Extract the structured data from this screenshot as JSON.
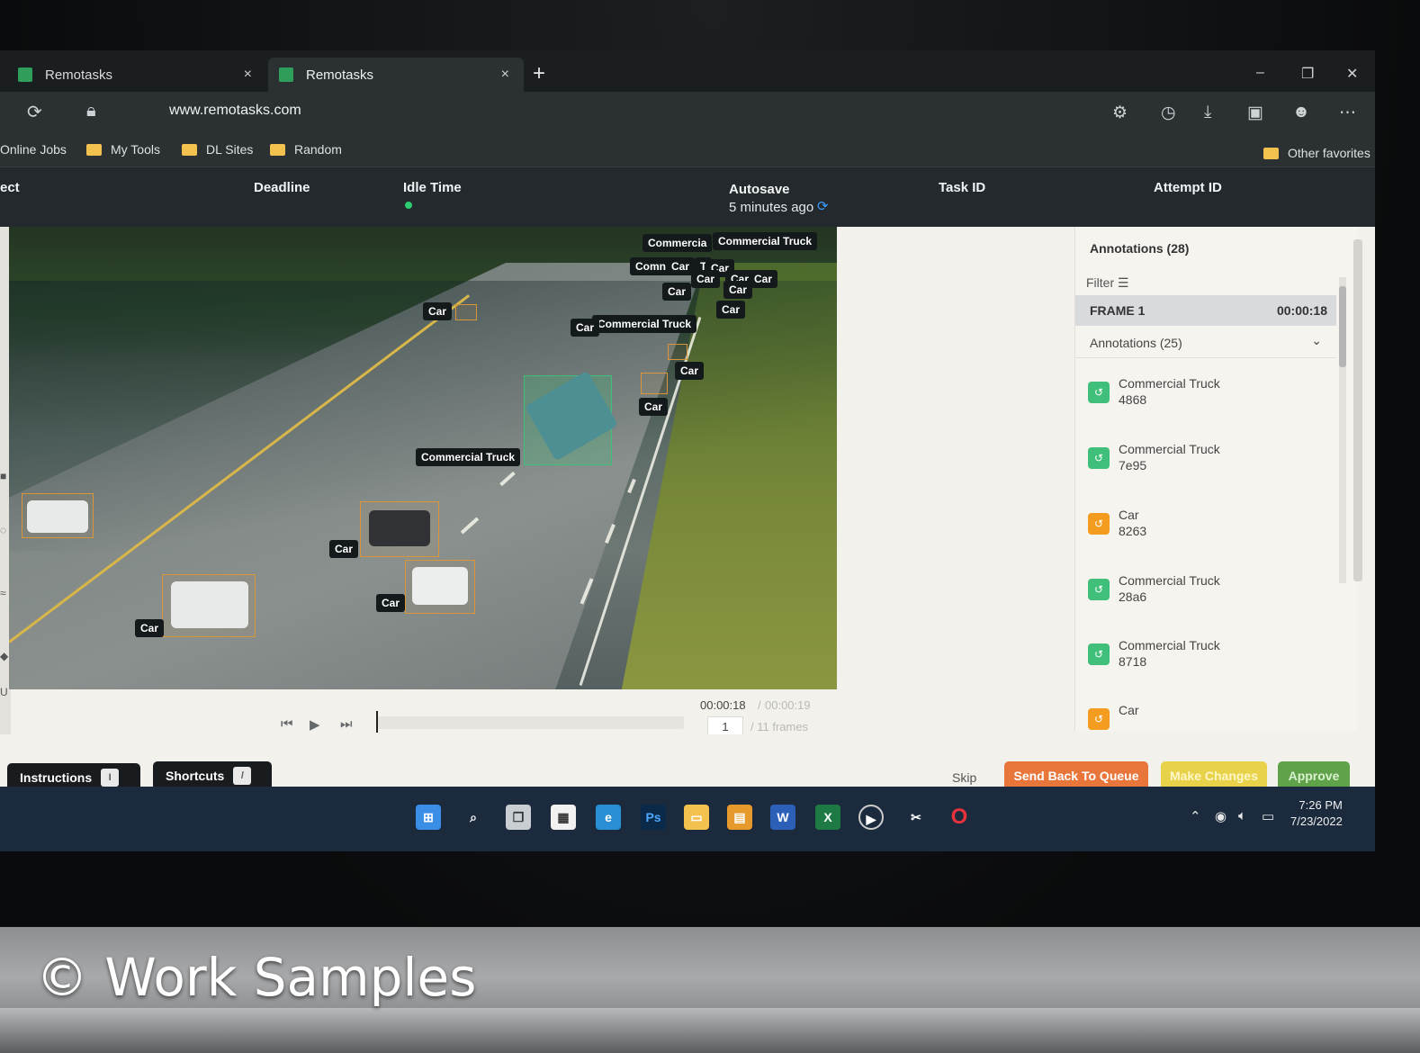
{
  "browser": {
    "tabs": [
      {
        "label": "Remotasks",
        "close": "×"
      },
      {
        "label": "Remotasks",
        "close": "×"
      }
    ],
    "new_tab": "+",
    "window_controls": [
      "–",
      "❐",
      "✕"
    ],
    "url": "www.remotasks.com",
    "favorites": [
      "Online Jobs",
      "My Tools",
      "DL Sites",
      "Random"
    ],
    "other_favorites": "Other favorites"
  },
  "task_header": {
    "project_label": "ect",
    "deadline_label": "Deadline",
    "idle_time_label": "Idle Time",
    "autosave_label": "Autosave",
    "autosave_value": "5 minutes ago",
    "task_id_label": "Task ID",
    "attempt_id_label": "Attempt ID"
  },
  "video_tags": [
    "Commercia",
    "Commercial Truck",
    "Comn",
    "Car",
    "T",
    "Car",
    "Car",
    "Car",
    "Car",
    "Car",
    "Car",
    "Car",
    "Car",
    "Commercial Truck",
    "Car",
    "Car",
    "Commercial Truck",
    "Car",
    "Car",
    "Car",
    "Car"
  ],
  "playback": {
    "current_time": "00:00:18",
    "separator": "/",
    "total_time": "00:00:19",
    "frame_number": "1",
    "frames_label": "/ 11 frames"
  },
  "annotations_panel": {
    "title": "Annotations (28)",
    "filter_label": "Filter",
    "frame_label": "FRAME 1",
    "frame_time": "00:00:18",
    "sub_label": "Annotations (25)",
    "items": [
      {
        "name": "Commercial Truck",
        "id": "4868",
        "color": "#3fbf7a"
      },
      {
        "name": "Commercial Truck",
        "id": "7e95",
        "color": "#3fbf7a"
      },
      {
        "name": "Car",
        "id": "8263",
        "color": "#f39c1f"
      },
      {
        "name": "Commercial Truck",
        "id": "28a6",
        "color": "#3fbf7a"
      },
      {
        "name": "Commercial Truck",
        "id": "8718",
        "color": "#3fbf7a"
      },
      {
        "name": "Car",
        "id": "",
        "color": "#f39c1f"
      }
    ]
  },
  "actions": {
    "instructions": "Instructions",
    "instructions_key": "I",
    "shortcuts": "Shortcuts",
    "shortcuts_key": "/",
    "skip": "Skip",
    "send_back": "Send Back To Queue",
    "make_changes": "Make Changes",
    "approve": "Approve"
  },
  "taskbar": {
    "time": "7:26 PM",
    "date": "7/23/2022"
  },
  "watermark": "© Work Samples"
}
